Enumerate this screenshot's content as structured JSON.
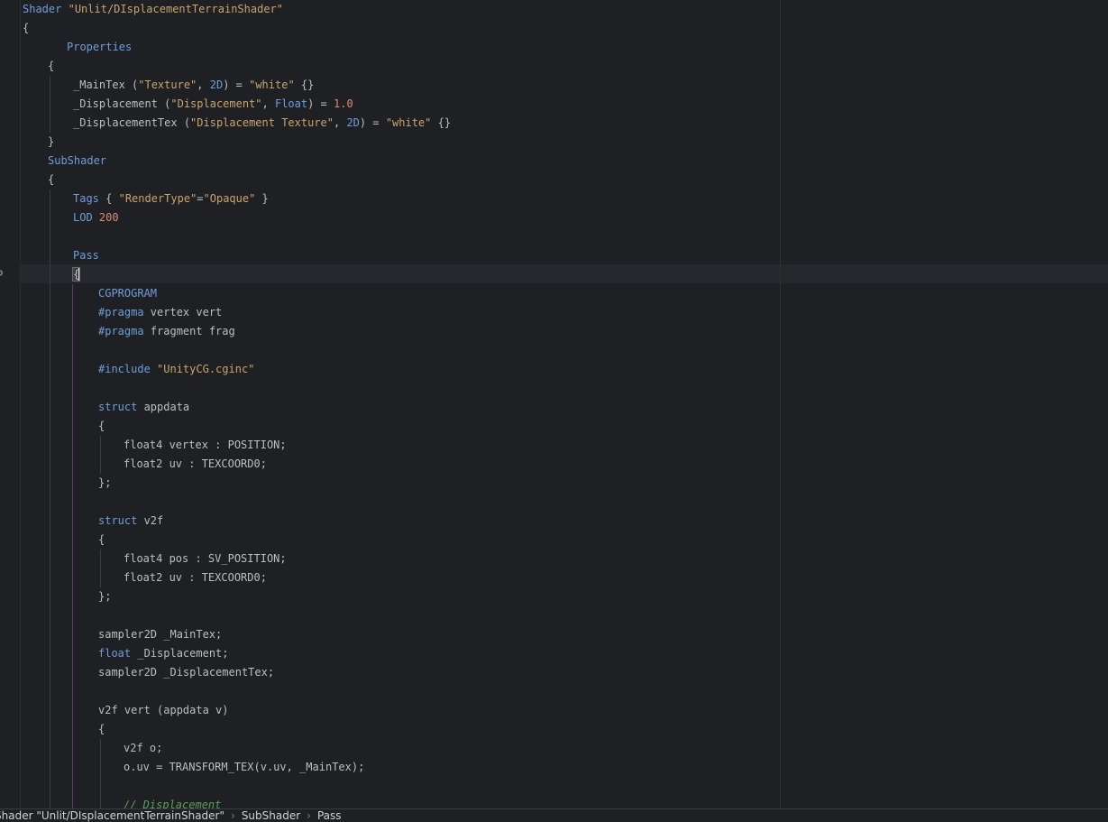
{
  "editor": {
    "lines": [
      [
        [
          "kw",
          "Shader"
        ],
        [
          "punc",
          " "
        ],
        [
          "str",
          "\"Unlit/DIsplacementTerrainShader\""
        ]
      ],
      [
        [
          "punc",
          "{"
        ]
      ],
      [
        [
          "kw",
          "Properties"
        ]
      ],
      [
        [
          "punc",
          "{"
        ]
      ],
      [
        [
          "punc",
          "_MainTex ("
        ],
        [
          "str",
          "\"Texture\""
        ],
        [
          "punc",
          ", "
        ],
        [
          "kw",
          "2D"
        ],
        [
          "punc",
          ") = "
        ],
        [
          "str",
          "\"white\""
        ],
        [
          "punc",
          " {}"
        ]
      ],
      [
        [
          "punc",
          "_Displacement ("
        ],
        [
          "str",
          "\"Displacement\""
        ],
        [
          "punc",
          ", "
        ],
        [
          "kw",
          "Float"
        ],
        [
          "punc",
          ") = "
        ],
        [
          "num",
          "1.0"
        ]
      ],
      [
        [
          "punc",
          "_DisplacementTex ("
        ],
        [
          "str",
          "\"Displacement Texture\""
        ],
        [
          "punc",
          ", "
        ],
        [
          "kw",
          "2D"
        ],
        [
          "punc",
          ") = "
        ],
        [
          "str",
          "\"white\""
        ],
        [
          "punc",
          " {}"
        ]
      ],
      [
        [
          "punc",
          "}"
        ]
      ],
      [
        [
          "kw",
          "SubShader"
        ]
      ],
      [
        [
          "punc",
          "{"
        ]
      ],
      [
        [
          "kw",
          "Tags"
        ],
        [
          "punc",
          " { "
        ],
        [
          "str",
          "\"RenderType\""
        ],
        [
          "punc",
          "="
        ],
        [
          "str",
          "\"Opaque\""
        ],
        [
          "punc",
          " }"
        ]
      ],
      [
        [
          "kw",
          "LOD"
        ],
        [
          "punc",
          " "
        ],
        [
          "num",
          "200"
        ]
      ],
      [],
      [
        [
          "kw",
          "Pass"
        ]
      ],
      [
        [
          "punc",
          "{"
        ]
      ],
      [
        [
          "kw",
          "CGPROGRAM"
        ]
      ],
      [
        [
          "kw",
          "#pragma"
        ],
        [
          "punc",
          " vertex vert"
        ]
      ],
      [
        [
          "kw",
          "#pragma"
        ],
        [
          "punc",
          " fragment frag"
        ]
      ],
      [],
      [
        [
          "kw",
          "#include"
        ],
        [
          "punc",
          " "
        ],
        [
          "str",
          "\"UnityCG.cginc\""
        ]
      ],
      [],
      [
        [
          "kw",
          "struct"
        ],
        [
          "punc",
          " appdata"
        ]
      ],
      [
        [
          "punc",
          "{"
        ]
      ],
      [
        [
          "punc",
          "float4 vertex : POSITION;"
        ]
      ],
      [
        [
          "punc",
          "float2 uv : TEXCOORD0;"
        ]
      ],
      [
        [
          "punc",
          "};"
        ]
      ],
      [],
      [
        [
          "kw",
          "struct"
        ],
        [
          "punc",
          " v2f"
        ]
      ],
      [
        [
          "punc",
          "{"
        ]
      ],
      [
        [
          "punc",
          "float4 pos : SV_POSITION;"
        ]
      ],
      [
        [
          "punc",
          "float2 uv : TEXCOORD0;"
        ]
      ],
      [
        [
          "punc",
          "};"
        ]
      ],
      [],
      [
        [
          "punc",
          "sampler2D _MainTex;"
        ]
      ],
      [
        [
          "kw",
          "float"
        ],
        [
          "punc",
          " _Displacement;"
        ]
      ],
      [
        [
          "punc",
          "sampler2D _DisplacementTex;"
        ]
      ],
      [],
      [
        [
          "punc",
          "v2f vert (appdata v)"
        ]
      ],
      [
        [
          "punc",
          "{"
        ]
      ],
      [
        [
          "punc",
          "v2f o;"
        ]
      ],
      [
        [
          "punc",
          "o.uv = TRANSFORM_TEX(v.uv, _MainTex);"
        ]
      ],
      [],
      [
        [
          "cmt",
          "// Displacement"
        ]
      ]
    ]
  },
  "breadcrumb": {
    "items": [
      "Shader \"Unlit/DIsplacementTerrainShader\"",
      "SubShader",
      "Pass"
    ],
    "separator": "›"
  },
  "icons": {
    "gutter": "gear-icon"
  }
}
